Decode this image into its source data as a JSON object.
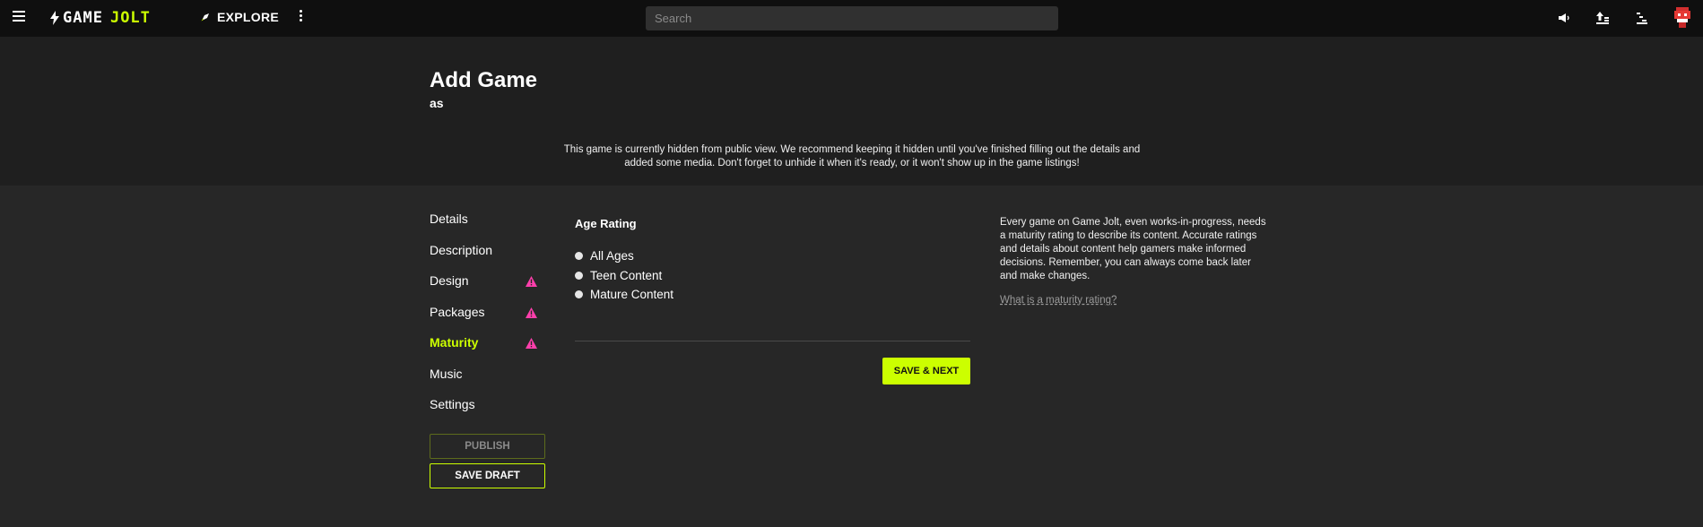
{
  "topbar": {
    "logo_left": "GAME",
    "logo_right": "JOLT",
    "explore_label": "EXPLORE",
    "search_placeholder": "Search",
    "icons": [
      "menu-icon",
      "rocket-icon",
      "more-vert-icon",
      "megaphone-icon",
      "upload-icon",
      "sort-icon",
      "avatar"
    ]
  },
  "header": {
    "title": "Add Game",
    "subtitle": "as",
    "notice": "This game is currently hidden from public view. We recommend keeping it hidden until you've finished filling out the details and added some media. Don't forget to unhide it when it's ready, or it won't show up in the game listings!"
  },
  "nav": {
    "items": [
      {
        "label": "Details",
        "warning": false,
        "active": false
      },
      {
        "label": "Description",
        "warning": false,
        "active": false
      },
      {
        "label": "Design",
        "warning": true,
        "active": false
      },
      {
        "label": "Packages",
        "warning": true,
        "active": false
      },
      {
        "label": "Maturity",
        "warning": true,
        "active": true
      },
      {
        "label": "Music",
        "warning": false,
        "active": false
      },
      {
        "label": "Settings",
        "warning": false,
        "active": false
      }
    ],
    "publish_label": "PUBLISH",
    "save_draft_label": "SAVE DRAFT"
  },
  "form": {
    "section_title": "Age Rating",
    "options": [
      "All Ages",
      "Teen Content",
      "Mature Content"
    ],
    "save_next_label": "SAVE & NEXT"
  },
  "help": {
    "text": "Every game on Game Jolt, even works-in-progress, needs a maturity rating to describe its content. Accurate ratings and details about content help gamers make informed decisions. Remember, you can always come back later and make changes.",
    "link": "What is a maturity rating?"
  },
  "colors": {
    "accent": "#ccff00",
    "warning": "#ff3fac",
    "topbar_bg": "#0f0f0f",
    "header_bg": "#1f1f1f",
    "body_bg": "#272727"
  }
}
